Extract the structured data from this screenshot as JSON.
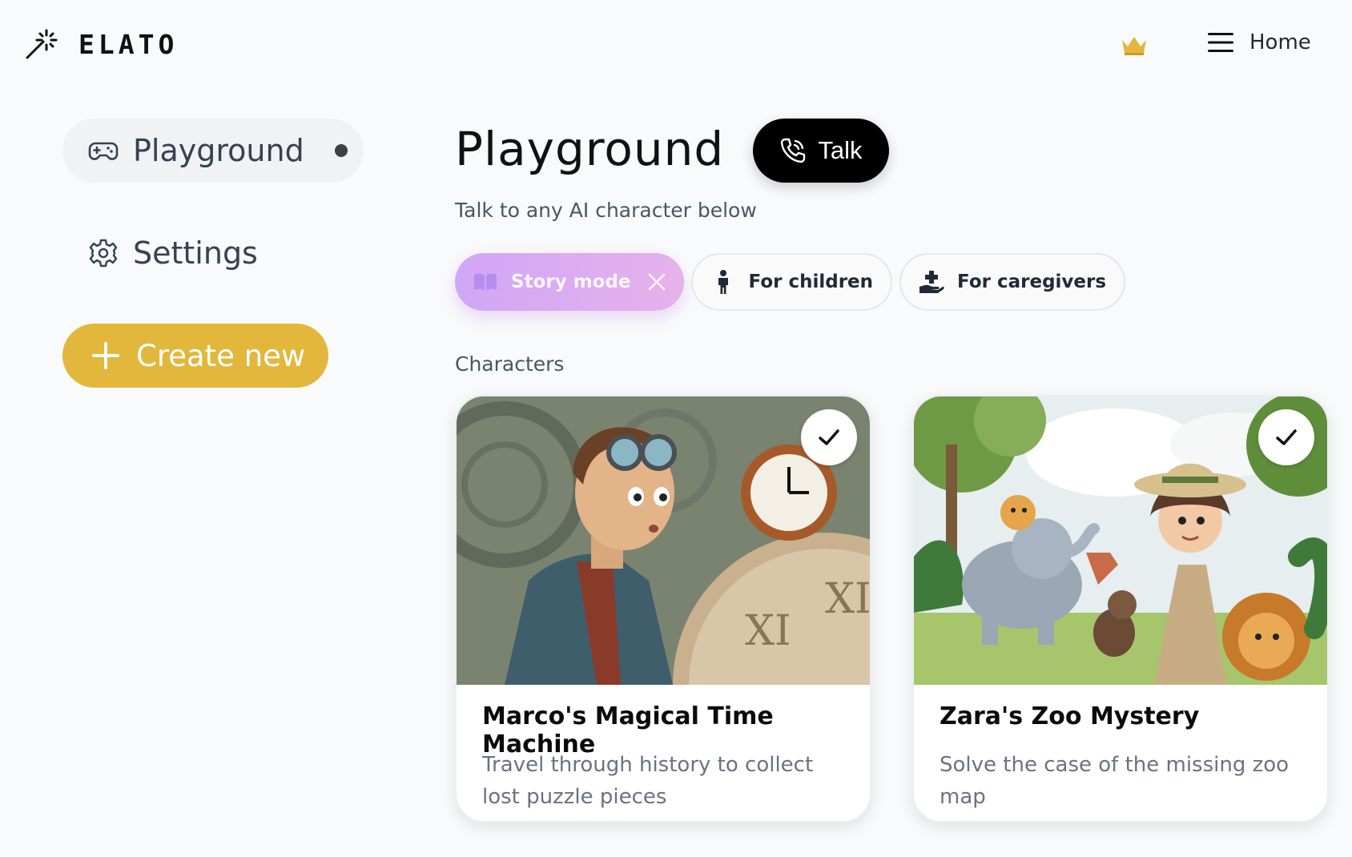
{
  "brand": {
    "name": "ELATO",
    "logo_icon": "magic-wand-icon"
  },
  "header": {
    "premium_icon": "crown-icon",
    "premium_color": "#e2b73c",
    "menu_label": "Home",
    "menu_icon": "hamburger-icon"
  },
  "sidebar": {
    "items": [
      {
        "label": "Playground",
        "icon": "gamepad-icon",
        "active": true
      },
      {
        "label": "Settings",
        "icon": "gear-icon",
        "active": false
      }
    ],
    "create_label": "Create new",
    "create_color": "#e2b73c"
  },
  "main": {
    "title": "Playground",
    "talk_label": "Talk",
    "subtitle": "Talk to any AI character below",
    "filters": [
      {
        "label": "Story mode",
        "icon": "book-icon",
        "active": true
      },
      {
        "label": "For children",
        "icon": "child-icon",
        "active": false
      },
      {
        "label": "For caregivers",
        "icon": "caregiver-hand-icon",
        "active": false
      }
    ],
    "section_label": "Characters",
    "characters": [
      {
        "title": "Marco's Magical Time Machine",
        "description": "Travel through history to collect lost puzzle pieces",
        "selected": true,
        "image": "boy-with-goggles-and-clock-illustration"
      },
      {
        "title": "Zara's Zoo Mystery",
        "description": "Solve the case of the missing zoo map",
        "selected": true,
        "image": "girl-explorer-with-zoo-animals-illustration"
      }
    ]
  }
}
